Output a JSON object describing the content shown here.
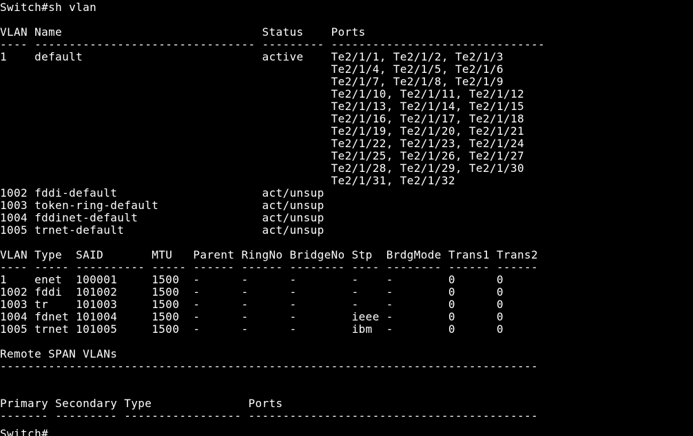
{
  "terminal": {
    "prompt_command": "Switch#sh vlan",
    "vlan_header": "VLAN Name                             Status    Ports",
    "vlan_separator": "---- -------------------------------- --------- -------------------------------",
    "vlan_rows": [
      "1    default                          active    Te2/1/1, Te2/1/2, Te2/1/3",
      "                                                Te2/1/4, Te2/1/5, Te2/1/6",
      "                                                Te2/1/7, Te2/1/8, Te2/1/9",
      "                                                Te2/1/10, Te2/1/11, Te2/1/12",
      "                                                Te2/1/13, Te2/1/14, Te2/1/15",
      "                                                Te2/1/16, Te2/1/17, Te2/1/18",
      "                                                Te2/1/19, Te2/1/20, Te2/1/21",
      "                                                Te2/1/22, Te2/1/23, Te2/1/24",
      "                                                Te2/1/25, Te2/1/26, Te2/1/27",
      "                                                Te2/1/28, Te2/1/29, Te2/1/30",
      "                                                Te2/1/31, Te2/1/32",
      "1002 fddi-default                     act/unsup",
      "1003 token-ring-default               act/unsup",
      "1004 fddinet-default                  act/unsup",
      "1005 trnet-default                    act/unsup"
    ],
    "type_header": "VLAN Type  SAID       MTU   Parent RingNo BridgeNo Stp  BrdgMode Trans1 Trans2",
    "type_separator": "---- ----- ---------- ----- ------ ------ -------- ---- -------- ------ ------",
    "type_rows": [
      "1    enet  100001     1500  -      -      -        -    -        0      0",
      "1002 fddi  101002     1500  -      -      -        -    -        0      0",
      "1003 tr    101003     1500  -      -      -        -    -        0      0",
      "1004 fdnet 101004     1500  -      -      -        ieee -        0      0",
      "1005 trnet 101005     1500  -      -      -        ibm  -        0      0"
    ],
    "rspan_title": "Remote SPAN VLANs",
    "rspan_separator": "------------------------------------------------------------------------------",
    "pvlan_header": "Primary Secondary Type              Ports",
    "pvlan_separator": "------- --------- ----------------- ------------------------------------------",
    "final_prompt": "Switch#"
  },
  "colors": {
    "background": "#000000",
    "text": "#ffffff"
  }
}
